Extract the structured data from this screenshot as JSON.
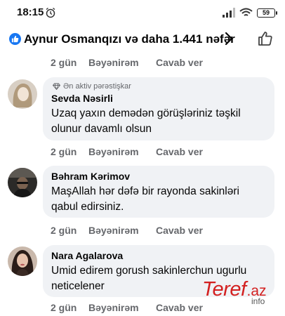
{
  "status_bar": {
    "time": "18:15",
    "battery": "59",
    "icons": [
      "alarm-icon",
      "signal-icon",
      "wifi-icon",
      "battery-icon"
    ]
  },
  "reactions": {
    "summary": "Aynur Osmanqızı və daha 1.441 nəfər",
    "icons": [
      "like-badge-icon",
      "chevron-right-icon",
      "like-outline-icon"
    ],
    "accent_color": "#1877f2"
  },
  "first_actions": {
    "time": "2 gün",
    "like": "Bəyənirəm",
    "reply": "Cavab ver"
  },
  "comments": [
    {
      "badge": "Ən aktiv pərəstişkar",
      "author": "Sevda Nəsirli",
      "text": "Uzaq yaxın demədən görüşləriniz təşkil olunur davamlı olsun",
      "time": "2 gün",
      "like": "Bəyənirəm",
      "reply": "Cavab ver"
    },
    {
      "author": "Bəhram Kərimov",
      "text": "MaşAllah hər dəfə bir rayonda sakinləri qabul edirsiniz.",
      "time": "2 gün",
      "like": "Bəyənirəm",
      "reply": "Cavab ver"
    },
    {
      "author": "Nara Agalarova",
      "text": "Umid edirem gorush sakinlerchun ugurlu neticelener",
      "time": "2 gün",
      "like": "Bəyənirəm",
      "reply": "Cavab ver"
    }
  ],
  "watermark": {
    "brand": "Teref",
    "tld": ".az",
    "sub": "info"
  },
  "colors": {
    "bubble": "#f0f2f5",
    "meta": "#65676b",
    "text": "#050505",
    "watermark": "#d32020"
  }
}
